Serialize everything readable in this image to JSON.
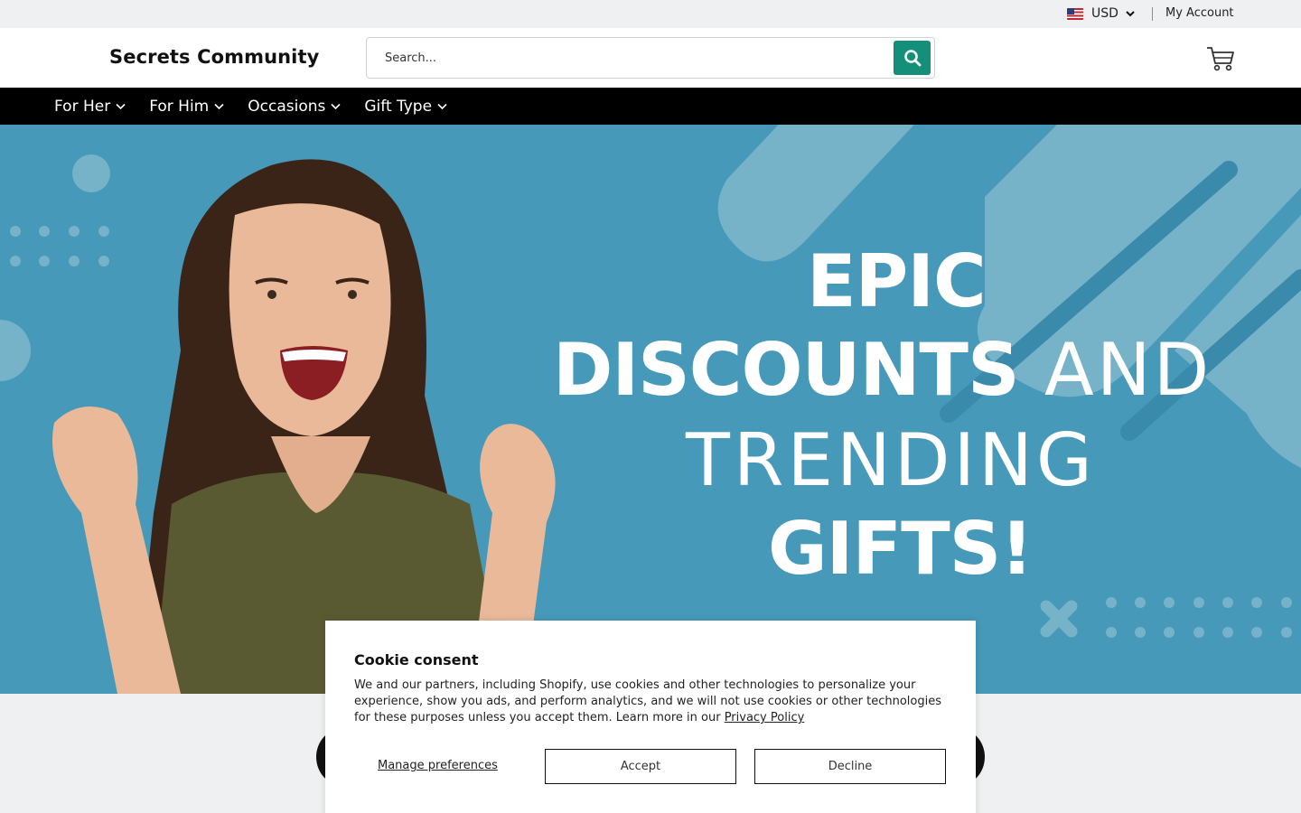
{
  "topbar": {
    "currency": "USD",
    "my_account": "My Account"
  },
  "header": {
    "logo": "Secrets Community",
    "search_placeholder": "Search..."
  },
  "nav": {
    "items": [
      {
        "label": "For Her"
      },
      {
        "label": "For Him"
      },
      {
        "label": "Occasions"
      },
      {
        "label": "Gift Type"
      }
    ]
  },
  "hero": {
    "line1": "EPIC",
    "line2_bold": "DISCOUNTS",
    "line2_thin": " AND",
    "line3": "TRENDING",
    "line4": "GIFTS!"
  },
  "cookie": {
    "title": "Cookie consent",
    "text": "We and our partners, including Shopify, use cookies and other technologies to personalize your experience, show you ads, and perform analytics, and we will not use cookies or other technologies for these purposes unless you accept them. Learn more in our ",
    "privacy_link": "Privacy Policy",
    "manage": "Manage preferences",
    "accept": "Accept",
    "decline": "Decline"
  },
  "colors": {
    "accent": "#14907a",
    "hero_bg": "#4699b9",
    "nav_bg": "#000000",
    "topbar_bg": "#eef0f1"
  },
  "icons": {
    "search": "search-icon",
    "cart": "cart-icon",
    "chevron": "chevron-down-icon",
    "flag": "us-flag-icon"
  }
}
